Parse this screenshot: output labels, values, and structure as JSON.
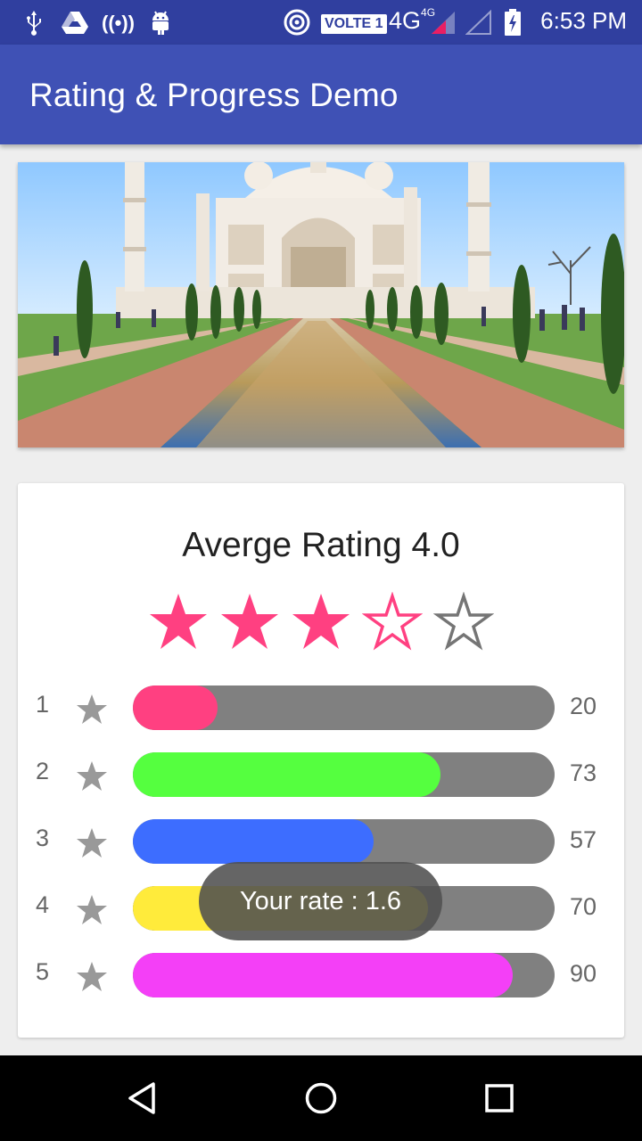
{
  "status_bar": {
    "time": "6:53 PM",
    "volte_label": "VOLTE 1",
    "network_label": "4G",
    "network_sup": "4G",
    "icons": [
      "usb-icon",
      "drive-icon",
      "hotspot-icon",
      "android-icon",
      "wifi-call-icon",
      "signal-icon",
      "signal-empty-icon",
      "battery-icon"
    ]
  },
  "app_bar": {
    "title": "Rating & Progress Demo"
  },
  "hero": {
    "image_subject": "taj-mahal-photo"
  },
  "rating_card": {
    "title": "Averge Rating 4.0",
    "stars": {
      "filled": 3,
      "total": 5
    },
    "rows": [
      {
        "label": "1",
        "count": "20",
        "value": 20,
        "color": "#ff4081"
      },
      {
        "label": "2",
        "count": "73",
        "value": 73,
        "color": "#55ff3f"
      },
      {
        "label": "3",
        "count": "57",
        "value": 57,
        "color": "#3d6dff"
      },
      {
        "label": "4",
        "count": "70",
        "value": 70,
        "color": "#ffeb3b"
      },
      {
        "label": "5",
        "count": "90",
        "value": 90,
        "color": "#f43ff7"
      }
    ]
  },
  "toast": {
    "text": "Your rate : 1.6"
  },
  "colors": {
    "primary": "#3f51b5",
    "primary_dark": "#303f9f",
    "accent": "#ff4081"
  },
  "nav_bar": {
    "buttons": [
      "back-icon",
      "home-icon",
      "recents-icon"
    ]
  }
}
